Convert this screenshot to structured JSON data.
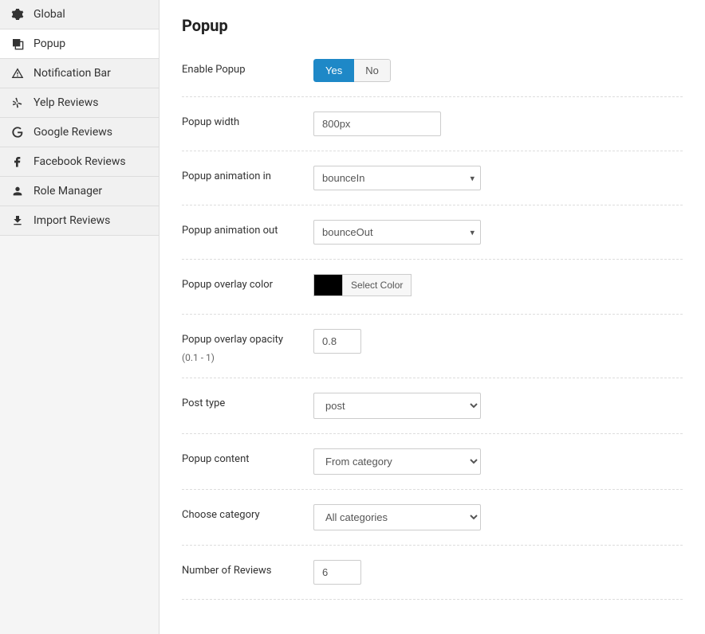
{
  "sidebar": {
    "items": [
      {
        "label": "Global",
        "icon": "gears"
      },
      {
        "label": "Popup",
        "icon": "overlay",
        "active": true
      },
      {
        "label": "Notification Bar",
        "icon": "warning"
      },
      {
        "label": "Yelp Reviews",
        "icon": "yelp"
      },
      {
        "label": "Google Reviews",
        "icon": "google"
      },
      {
        "label": "Facebook Reviews",
        "icon": "facebook"
      },
      {
        "label": "Role Manager",
        "icon": "user"
      },
      {
        "label": "Import Reviews",
        "icon": "download"
      }
    ]
  },
  "page": {
    "title": "Popup"
  },
  "form": {
    "enable_popup": {
      "label": "Enable Popup",
      "value": "Yes",
      "options": [
        "Yes",
        "No"
      ]
    },
    "popup_width": {
      "label": "Popup width",
      "value": "800px"
    },
    "animation_in": {
      "label": "Popup animation in",
      "value": "bounceIn"
    },
    "animation_out": {
      "label": "Popup animation out",
      "value": "bounceOut"
    },
    "overlay_color": {
      "label": "Popup overlay color",
      "button": "Select Color",
      "value": "#000000"
    },
    "overlay_opacity": {
      "label": "Popup overlay opacity",
      "sublabel": "(0.1 - 1)",
      "value": "0.8"
    },
    "post_type": {
      "label": "Post type",
      "value": "post"
    },
    "popup_content": {
      "label": "Popup content",
      "value": "From category"
    },
    "choose_category": {
      "label": "Choose category",
      "value": "All categories"
    },
    "number_reviews": {
      "label": "Number of Reviews",
      "value": "6"
    }
  }
}
